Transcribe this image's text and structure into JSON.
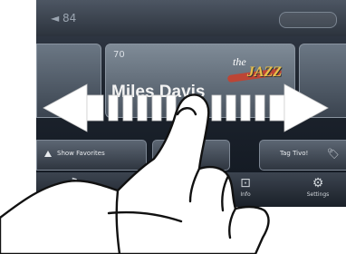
{
  "status": {
    "left_text": "◄ 84"
  },
  "card": {
    "channel_number": "70",
    "artist": "Miles Davis",
    "logo_the": "the",
    "logo_name": "JAZZ"
  },
  "buttons": {
    "favorites_label": "Show Favorites",
    "tag_label": "Tag Tivo!"
  },
  "nav": {
    "item1_label": "",
    "item2_label": "",
    "item3_label": "Info",
    "item4_label": "Settings"
  },
  "colors": {
    "accent_gold": "#e8c04a",
    "logo_red": "#c7402d",
    "arrow": "#ffffff"
  },
  "icons": [
    "music-note-icon",
    "triangle-up-icon",
    "tag-icon",
    "info-icon",
    "gear-icon",
    "swipe-arrows-icon",
    "hand-pointer-icon"
  ]
}
